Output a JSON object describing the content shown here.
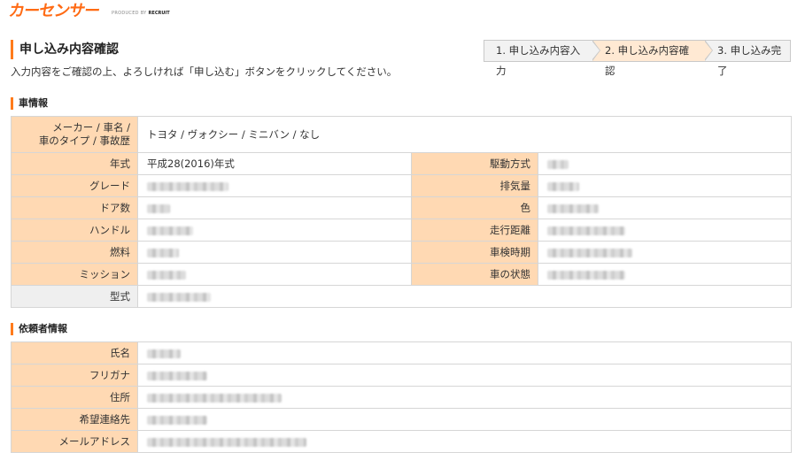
{
  "brand": {
    "logo_text": "カーセンサー",
    "produced_by": "PRODUCED BY",
    "recruit": "RECRUIT"
  },
  "page": {
    "title": "申し込み内容確認",
    "instruction": "入力内容をご確認の上、よろしければ「申し込む」ボタンをクリックしてください。"
  },
  "steps": [
    {
      "label": "1. 申し込み内容入力",
      "active": false
    },
    {
      "label": "2. 申し込み内容確認",
      "active": true
    },
    {
      "label": "3. 申し込み完了",
      "active": false
    }
  ],
  "car_section": {
    "title": "車情報",
    "maker_label_line1": "メーカー / 車名 /",
    "maker_label_line2": "車のタイプ / 事故歴",
    "maker_value": "トヨタ / ヴォクシー / ミニバン / なし",
    "rows": [
      {
        "label_left": "年式",
        "value_left": "平成28(2016)年式",
        "label_right": "駆動方式",
        "value_right": ""
      },
      {
        "label_left": "グレード",
        "value_left": "",
        "label_right": "排気量",
        "value_right": ""
      },
      {
        "label_left": "ドア数",
        "value_left": "",
        "label_right": "色",
        "value_right": ""
      },
      {
        "label_left": "ハンドル",
        "value_left": "",
        "label_right": "走行距離",
        "value_right": ""
      },
      {
        "label_left": "燃料",
        "value_left": "",
        "label_right": "車検時期",
        "value_right": ""
      },
      {
        "label_left": "ミッション",
        "value_left": "",
        "label_right": "車の状態",
        "value_right": ""
      }
    ],
    "model_label": "型式",
    "model_value": ""
  },
  "requester_section": {
    "title": "依頼者情報",
    "rows": [
      {
        "label": "氏名",
        "value": ""
      },
      {
        "label": "フリガナ",
        "value": ""
      },
      {
        "label": "住所",
        "value": ""
      },
      {
        "label": "希望連絡先",
        "value": ""
      },
      {
        "label": "メールアドレス",
        "value": ""
      }
    ]
  },
  "colors": {
    "accent": "#ff7b1c",
    "label_bg": "#ffd9b3",
    "active_step_bg": "#ffe9d3"
  }
}
